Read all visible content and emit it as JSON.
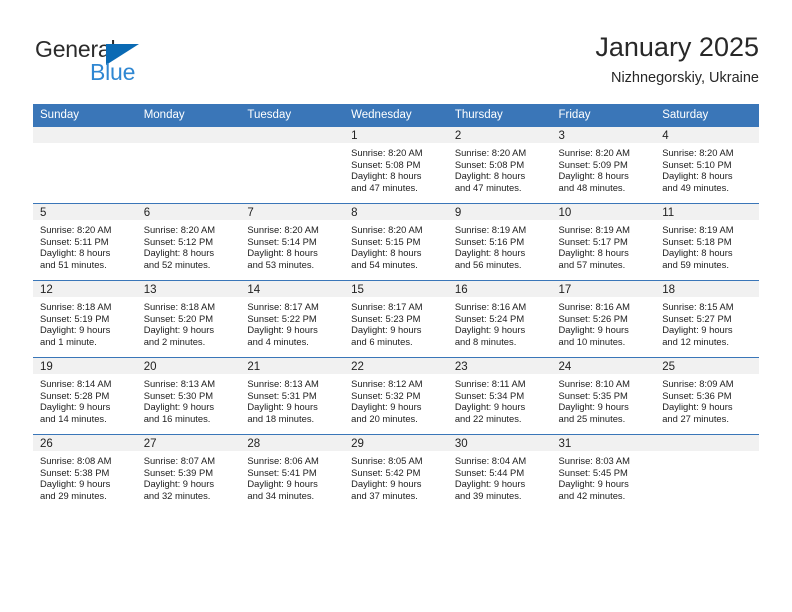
{
  "brand": {
    "name_part1": "General",
    "name_part2": "Blue",
    "triangle_color": "#0a6ab4",
    "blue_color": "#2f87d2"
  },
  "header": {
    "title": "January 2025",
    "subtitle": "Nizhnegorskiy, Ukraine"
  },
  "colors": {
    "header_bar": "#3a76b8",
    "day_band": "#f1f1f1",
    "text": "#1d1d1d"
  },
  "weekdays": [
    "Sunday",
    "Monday",
    "Tuesday",
    "Wednesday",
    "Thursday",
    "Friday",
    "Saturday"
  ],
  "weeks": [
    [
      {
        "day": "",
        "blank": true
      },
      {
        "day": "",
        "blank": true
      },
      {
        "day": "",
        "blank": true
      },
      {
        "day": "1",
        "sunrise": "Sunrise: 8:20 AM",
        "sunset": "Sunset: 5:08 PM",
        "daylight1": "Daylight: 8 hours",
        "daylight2": "and 47 minutes."
      },
      {
        "day": "2",
        "sunrise": "Sunrise: 8:20 AM",
        "sunset": "Sunset: 5:08 PM",
        "daylight1": "Daylight: 8 hours",
        "daylight2": "and 47 minutes."
      },
      {
        "day": "3",
        "sunrise": "Sunrise: 8:20 AM",
        "sunset": "Sunset: 5:09 PM",
        "daylight1": "Daylight: 8 hours",
        "daylight2": "and 48 minutes."
      },
      {
        "day": "4",
        "sunrise": "Sunrise: 8:20 AM",
        "sunset": "Sunset: 5:10 PM",
        "daylight1": "Daylight: 8 hours",
        "daylight2": "and 49 minutes."
      }
    ],
    [
      {
        "day": "5",
        "sunrise": "Sunrise: 8:20 AM",
        "sunset": "Sunset: 5:11 PM",
        "daylight1": "Daylight: 8 hours",
        "daylight2": "and 51 minutes."
      },
      {
        "day": "6",
        "sunrise": "Sunrise: 8:20 AM",
        "sunset": "Sunset: 5:12 PM",
        "daylight1": "Daylight: 8 hours",
        "daylight2": "and 52 minutes."
      },
      {
        "day": "7",
        "sunrise": "Sunrise: 8:20 AM",
        "sunset": "Sunset: 5:14 PM",
        "daylight1": "Daylight: 8 hours",
        "daylight2": "and 53 minutes."
      },
      {
        "day": "8",
        "sunrise": "Sunrise: 8:20 AM",
        "sunset": "Sunset: 5:15 PM",
        "daylight1": "Daylight: 8 hours",
        "daylight2": "and 54 minutes."
      },
      {
        "day": "9",
        "sunrise": "Sunrise: 8:19 AM",
        "sunset": "Sunset: 5:16 PM",
        "daylight1": "Daylight: 8 hours",
        "daylight2": "and 56 minutes."
      },
      {
        "day": "10",
        "sunrise": "Sunrise: 8:19 AM",
        "sunset": "Sunset: 5:17 PM",
        "daylight1": "Daylight: 8 hours",
        "daylight2": "and 57 minutes."
      },
      {
        "day": "11",
        "sunrise": "Sunrise: 8:19 AM",
        "sunset": "Sunset: 5:18 PM",
        "daylight1": "Daylight: 8 hours",
        "daylight2": "and 59 minutes."
      }
    ],
    [
      {
        "day": "12",
        "sunrise": "Sunrise: 8:18 AM",
        "sunset": "Sunset: 5:19 PM",
        "daylight1": "Daylight: 9 hours",
        "daylight2": "and 1 minute."
      },
      {
        "day": "13",
        "sunrise": "Sunrise: 8:18 AM",
        "sunset": "Sunset: 5:20 PM",
        "daylight1": "Daylight: 9 hours",
        "daylight2": "and 2 minutes."
      },
      {
        "day": "14",
        "sunrise": "Sunrise: 8:17 AM",
        "sunset": "Sunset: 5:22 PM",
        "daylight1": "Daylight: 9 hours",
        "daylight2": "and 4 minutes."
      },
      {
        "day": "15",
        "sunrise": "Sunrise: 8:17 AM",
        "sunset": "Sunset: 5:23 PM",
        "daylight1": "Daylight: 9 hours",
        "daylight2": "and 6 minutes."
      },
      {
        "day": "16",
        "sunrise": "Sunrise: 8:16 AM",
        "sunset": "Sunset: 5:24 PM",
        "daylight1": "Daylight: 9 hours",
        "daylight2": "and 8 minutes."
      },
      {
        "day": "17",
        "sunrise": "Sunrise: 8:16 AM",
        "sunset": "Sunset: 5:26 PM",
        "daylight1": "Daylight: 9 hours",
        "daylight2": "and 10 minutes."
      },
      {
        "day": "18",
        "sunrise": "Sunrise: 8:15 AM",
        "sunset": "Sunset: 5:27 PM",
        "daylight1": "Daylight: 9 hours",
        "daylight2": "and 12 minutes."
      }
    ],
    [
      {
        "day": "19",
        "sunrise": "Sunrise: 8:14 AM",
        "sunset": "Sunset: 5:28 PM",
        "daylight1": "Daylight: 9 hours",
        "daylight2": "and 14 minutes."
      },
      {
        "day": "20",
        "sunrise": "Sunrise: 8:13 AM",
        "sunset": "Sunset: 5:30 PM",
        "daylight1": "Daylight: 9 hours",
        "daylight2": "and 16 minutes."
      },
      {
        "day": "21",
        "sunrise": "Sunrise: 8:13 AM",
        "sunset": "Sunset: 5:31 PM",
        "daylight1": "Daylight: 9 hours",
        "daylight2": "and 18 minutes."
      },
      {
        "day": "22",
        "sunrise": "Sunrise: 8:12 AM",
        "sunset": "Sunset: 5:32 PM",
        "daylight1": "Daylight: 9 hours",
        "daylight2": "and 20 minutes."
      },
      {
        "day": "23",
        "sunrise": "Sunrise: 8:11 AM",
        "sunset": "Sunset: 5:34 PM",
        "daylight1": "Daylight: 9 hours",
        "daylight2": "and 22 minutes."
      },
      {
        "day": "24",
        "sunrise": "Sunrise: 8:10 AM",
        "sunset": "Sunset: 5:35 PM",
        "daylight1": "Daylight: 9 hours",
        "daylight2": "and 25 minutes."
      },
      {
        "day": "25",
        "sunrise": "Sunrise: 8:09 AM",
        "sunset": "Sunset: 5:36 PM",
        "daylight1": "Daylight: 9 hours",
        "daylight2": "and 27 minutes."
      }
    ],
    [
      {
        "day": "26",
        "sunrise": "Sunrise: 8:08 AM",
        "sunset": "Sunset: 5:38 PM",
        "daylight1": "Daylight: 9 hours",
        "daylight2": "and 29 minutes."
      },
      {
        "day": "27",
        "sunrise": "Sunrise: 8:07 AM",
        "sunset": "Sunset: 5:39 PM",
        "daylight1": "Daylight: 9 hours",
        "daylight2": "and 32 minutes."
      },
      {
        "day": "28",
        "sunrise": "Sunrise: 8:06 AM",
        "sunset": "Sunset: 5:41 PM",
        "daylight1": "Daylight: 9 hours",
        "daylight2": "and 34 minutes."
      },
      {
        "day": "29",
        "sunrise": "Sunrise: 8:05 AM",
        "sunset": "Sunset: 5:42 PM",
        "daylight1": "Daylight: 9 hours",
        "daylight2": "and 37 minutes."
      },
      {
        "day": "30",
        "sunrise": "Sunrise: 8:04 AM",
        "sunset": "Sunset: 5:44 PM",
        "daylight1": "Daylight: 9 hours",
        "daylight2": "and 39 minutes."
      },
      {
        "day": "31",
        "sunrise": "Sunrise: 8:03 AM",
        "sunset": "Sunset: 5:45 PM",
        "daylight1": "Daylight: 9 hours",
        "daylight2": "and 42 minutes."
      },
      {
        "day": "",
        "blank": true
      }
    ]
  ]
}
